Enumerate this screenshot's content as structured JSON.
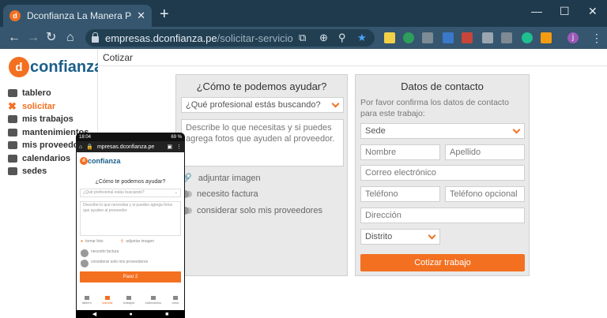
{
  "browser": {
    "tab_title": "Dconfianza La Manera Práctica D",
    "tab_favicon": "d",
    "url_host": "empresas.dconfianza.pe",
    "url_path": "/solicitar-servicio",
    "profile_initial": "j",
    "extension_badge": "0"
  },
  "logo": {
    "mark": "d",
    "word": "confianza"
  },
  "sidebar": {
    "items": [
      {
        "label": "tablero",
        "icon": "dashboard-icon"
      },
      {
        "label": "solicitar",
        "icon": "tools-icon",
        "active": true
      },
      {
        "label": "mis trabajos",
        "icon": "clipboard-icon"
      },
      {
        "label": "mantenimientos",
        "icon": "wrench-icon"
      },
      {
        "label": "mis proveedores",
        "icon": "building-icon"
      },
      {
        "label": "calendarios",
        "icon": "calendar-icon"
      },
      {
        "label": "sedes",
        "icon": "office-icon"
      }
    ]
  },
  "main": {
    "page_title": "Cotizar",
    "help": {
      "title": "¿Cómo te podemos ayudar?",
      "professional_placeholder": "¿Qué profesional estás buscando?",
      "description_placeholder": "Describe lo que necesitas y si puedes agrega fotos que ayuden al proveedor.",
      "attach_label": "adjuntar imagen",
      "invoice_label": "necesito factura",
      "own_providers_label": "considerar solo mis proveedores"
    },
    "contact": {
      "title": "Datos de contacto",
      "subtitle": "Por favor confirma los datos de contacto para este trabajo:",
      "sede": "Sede",
      "nombre": "Nombre",
      "apellido": "Apellido",
      "correo": "Correo electrónico",
      "telefono": "Teléfono",
      "telefono_opcional": "Teléfono opcional",
      "direccion": "Dirección",
      "distrito": "Distrito",
      "submit": "Cotizar trabajo"
    }
  },
  "phone": {
    "time": "18:04",
    "battery": "69 %",
    "url": "mpresas.dconfianza.pe",
    "heading": "¿Cómo te podemos ayudar?",
    "professional_placeholder": "¿Qué profesional estás buscando?",
    "description_placeholder": "Describe lo que necesitas y si puedes agrega fotos que ayuden al proveedor.",
    "take_photo": "tomar foto",
    "attach": "adjuntar imagen",
    "invoice": "necesito factura",
    "own_providers": "considerar solo mis proveedores",
    "button": "Paso 2",
    "nav": [
      "tablero",
      "solicitar",
      "trabajos",
      "calendarios",
      "otros"
    ],
    "nav_badge": "1"
  },
  "colors": {
    "accent": "#f37021",
    "brand_blue": "#1a5e8a",
    "chrome": "#35566e"
  }
}
